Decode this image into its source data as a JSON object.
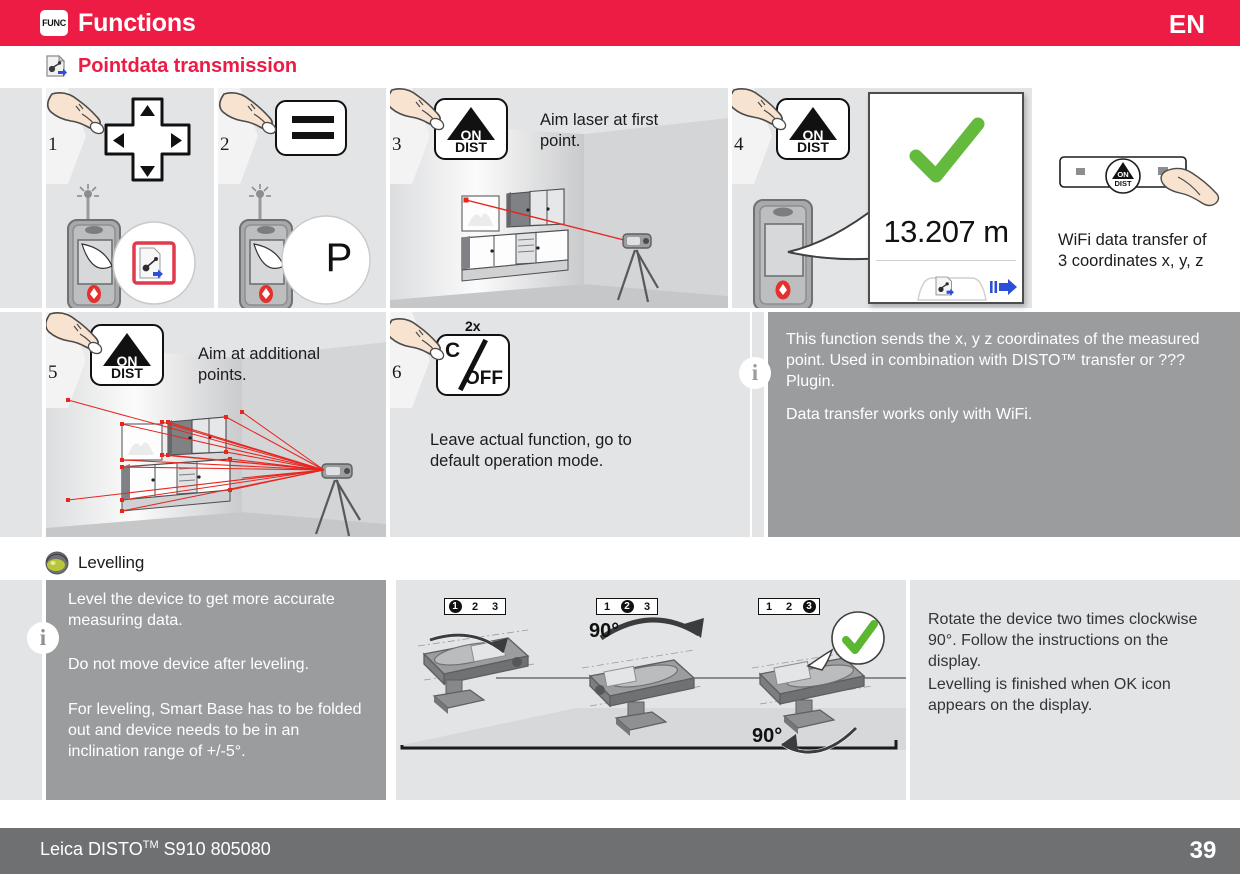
{
  "header": {
    "func_key_label": "FUNC",
    "title": "Functions",
    "language": "EN"
  },
  "sections": [
    {
      "id": "pointdata",
      "icon": "pointdata-transfer-icon",
      "title": "Pointdata transmission"
    },
    {
      "id": "levelling",
      "icon": "levelling-icon",
      "title": "Levelling"
    }
  ],
  "steps": [
    {
      "number": "1",
      "key": "dpad",
      "text": ""
    },
    {
      "number": "2",
      "key": "equals",
      "text": "",
      "bubble": "P"
    },
    {
      "number": "3",
      "key": "on-dist",
      "text": "Aim laser at first\npoint."
    },
    {
      "number": "4",
      "key": "on-dist",
      "text": ""
    },
    {
      "number": "5",
      "key": "on-dist",
      "text": "Aim at additional\npoints."
    },
    {
      "number": "6",
      "key": "c-off",
      "repeat": "2x",
      "text": "Leave actual function, go to\ndefault operation mode."
    }
  ],
  "display": {
    "value": "13.207 m",
    "ok_icon": "green-check-icon",
    "softkey_left": "pointdata-transfer-icon",
    "softkey_right": "send-arrow-icon"
  },
  "wifi_note": "WiFi data transfer of\n3 coordinates x, y, z",
  "info_pointdata": {
    "badge": "i",
    "paragraph1": "This function sends the x, y z coordinates of the measured point. Used in combination with DISTO™ transfer or ??? Plugin.",
    "paragraph2": "Data transfer works only with WiFi."
  },
  "info_levelling": {
    "badge": "i",
    "paragraph1": "Level the device to get more accurate measuring data.",
    "paragraph2": "Do not move device after leveling.",
    "paragraph3": "For leveling, Smart Base has to be folded out and device needs to be in an inclination range of +/-5°."
  },
  "levelling_note": {
    "paragraph1": "Rotate the device two times clockwise 90°. Follow the instructions on the display.",
    "paragraph2": "Levelling is finished when OK icon appears on the display."
  },
  "levelling_diagram": {
    "indicators": [
      {
        "items": [
          "1",
          "2",
          "3"
        ],
        "active": 0
      },
      {
        "items": [
          "1",
          "2",
          "3"
        ],
        "active": 1
      },
      {
        "items": [
          "1",
          "2",
          "3"
        ],
        "active": 2
      }
    ],
    "angle_top": "90°",
    "angle_bottom": "90°",
    "ok_icon": "green-check-icon"
  },
  "footer": {
    "text": "Leica DISTOTM S910 805080",
    "text_main": "Leica DISTO",
    "text_tm": "TM",
    "text_rest": " S910 805080",
    "page": "39"
  },
  "colors": {
    "brand_red": "#ec1c45",
    "panel_gray": "#e3e4e6",
    "panel_dark": "#9b9c9e",
    "footer_gray": "#6e7072",
    "laser_red": "#e8251f",
    "ok_green": "#5bb631"
  }
}
